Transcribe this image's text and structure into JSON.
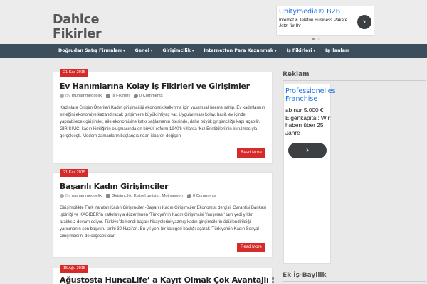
{
  "site": {
    "title_line1": "Dahice",
    "title_line2": "Fikirler"
  },
  "header_ad": {
    "title": "Unitymedia® B2B",
    "text": "Internet & Telefon Business Pakete. Jetzt für Ihr",
    "arrow": "›",
    "dots": 2
  },
  "nav": {
    "items": [
      {
        "label": "Doğrudan Satış Firmaları",
        "caret": "▾"
      },
      {
        "label": "Genel",
        "caret": "▾"
      },
      {
        "label": "Girişimcilik",
        "caret": "▾"
      },
      {
        "label": "İnternetten Para Kazanmak",
        "caret": "▾"
      },
      {
        "label": "İş Fikirleri",
        "caret": "▾"
      },
      {
        "label": "İş İlanları",
        "caret": ""
      }
    ]
  },
  "posts": [
    {
      "date": "21 Kas 2015",
      "title": "Ev Hanımlarına Kolay İş Fikirleri ve Girişimler",
      "by": "By",
      "author": "muhammedcelik",
      "category": "İş Fikirleri",
      "comments": "0 Comments",
      "excerpt": "Kadınlara Girişim Önerileri Kadın girişimciliği ekonomik kalkınma için yaşamsal öneme sahip. Ev kadınlarının emeğini ekonomiye kazandıracak girişimlere büyük ihtiyaç var. Uygulanması kolay, basit, ev içinde yapılabilecek girişimler, aile ekonomisine katkı sağlamanın ötesinde, daha büyük girişimciliğe kapı açabilir. GİRİŞİMCİ kadın kimliğinin oluşmasında en büyük reform 1940’lı yıllarda ‘Kız Enstitüleri’nin kurulmasıyla gerçekleşti. Modern zamanların başlangıcından itibaren değişen",
      "read_more": "Read More"
    },
    {
      "date": "21 Kas 2015",
      "title": "Başarılı Kadın Girişimciler",
      "by": "By",
      "author": "muhammedcelik",
      "category": "Girişimcilik, Kişisel gelişim, Motivasyon",
      "comments": "0 Comments",
      "excerpt": "Girişimcilikte Fark Yaratan Kadın Girişimciler -Başarılı Kadın Girişimciler Ekonomist dergisi, Garantisi Bankası işbirliği ve KAGİDER’in katkılarıyla düzenlenen ‘Türkiye’nin Kadın Girişimcisi Yarışması’ tam yedi yıldır aralıksız devam ediyor. Türkiye’de kendi başarı hikayelerini yazmış kadın girişimcilerin ödüllendirildiği yarışmanın son başvuru tarihi 30 Haziran. Bu yıl yeni bir kategori başlığı açarak ‘Türkiye’nin Kadın Sosyal Girişimcisi’ni de seçecek olan",
      "read_more": "Read More"
    },
    {
      "date": "15 Ağu 2015",
      "title": "Ağustosta HuncaLife’ a Kayıt Olmak Çok Avantajlı !"
    }
  ],
  "sidebar": {
    "reklam_title": "Reklam",
    "ad_title": "Professionelles Franchise",
    "ad_text": "ab nur 5.000 € Eigenkapital: Wir haben über 25 Jahre",
    "ad_arrow": "›",
    "second_title": "Ek İş-Bayilik"
  },
  "colors": {
    "accent": "#d62b2b",
    "nav_bg": "#3c4e5c",
    "ad_blue": "#1a73e8"
  }
}
